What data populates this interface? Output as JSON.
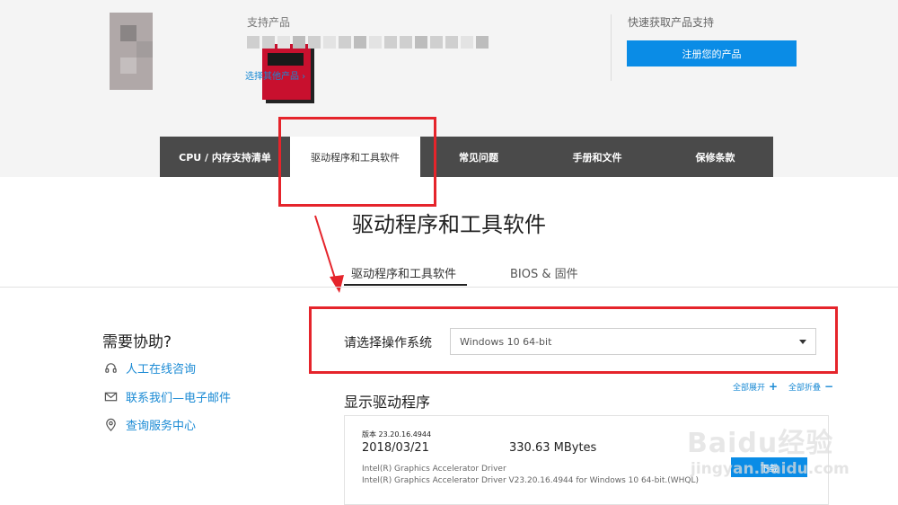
{
  "header": {
    "support_label": "支持产品",
    "choose_other": "选择其他产品 ›",
    "quick_label": "快速获取产品支持",
    "register_button": "注册您的产品"
  },
  "tabs": [
    {
      "label": "CPU / 内存支持清单"
    },
    {
      "label": "驱动程序和工具软件"
    },
    {
      "label": "常见问题"
    },
    {
      "label": "手册和文件"
    },
    {
      "label": "保修条款"
    }
  ],
  "page_title": "驱动程序和工具软件",
  "subtabs": [
    {
      "label": "驱动程序和工具软件"
    },
    {
      "label": "BIOS & 固件"
    }
  ],
  "help": {
    "title": "需要协助?",
    "items": [
      {
        "label": "人工在线咨询",
        "icon": "headset-icon"
      },
      {
        "label": "联系我们—电子邮件",
        "icon": "mail-icon"
      },
      {
        "label": "查询服务中心",
        "icon": "location-pin-icon"
      }
    ]
  },
  "os": {
    "label": "请选择操作系统",
    "selected": "Windows 10 64-bit"
  },
  "expand_all": "全部展开",
  "collapse_all": "全部折叠",
  "drivers_title": "显示驱动程序",
  "driver": {
    "version": "版本 23.20.16.4944",
    "date": "2018/03/21",
    "size": "330.63 MBytes",
    "name": "Intel(R) Graphics Accelerator Driver",
    "description": "Intel(R) Graphics Accelerator Driver V23.20.16.4944 for Windows 10 64-bit.(WHQL)",
    "download": "下载"
  },
  "watermark": {
    "text": "Baidu经验",
    "url": "jingyan.baidu.com"
  },
  "colors": {
    "accent": "#0a8ce6",
    "tab_bar": "#4a4a4a",
    "annotation_red": "#e5242b",
    "link": "#1a8ad4"
  }
}
